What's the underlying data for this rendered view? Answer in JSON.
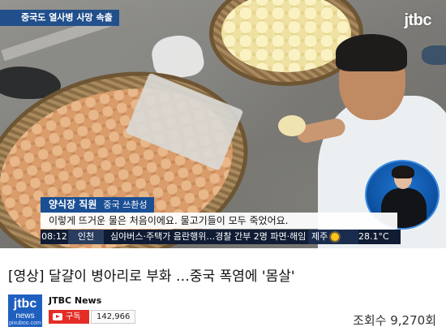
{
  "video": {
    "topic_tag": "중국도 열사병 사망 속출",
    "logo": "jtbc",
    "caption": {
      "name": "양식장 직원",
      "location": "중국 쓰촨성",
      "quote": "이렇게 뜨거운 물은 처음이에요. 물고기들이 모두 죽었어요."
    },
    "ticker": {
      "time": "08:12",
      "city": "인천",
      "headline": "심야버스·주택가 음란행위…경찰 간부 2명 파면·해임",
      "weather_location": "제주",
      "temperature": "28.1°C"
    }
  },
  "page": {
    "title": "[영상] 달걀이 병아리로 부화 …중국 폭염에 '몸살'",
    "channel_logo_line1": "jtbc",
    "channel_logo_line2": "news",
    "channel_logo_line3": "pixuboo.com",
    "channel_name": "JTBC News",
    "subscribe_label": "구독",
    "subscriber_count": "142,966",
    "views": "조회수 9,270회"
  },
  "colors": {
    "topic_bg": "#15488c",
    "caption_name_bg": "#1b4f94",
    "ticker_bg": "#0f1c33",
    "subscribe_red": "#e52d27",
    "channel_blue": "#1f5fbf"
  }
}
